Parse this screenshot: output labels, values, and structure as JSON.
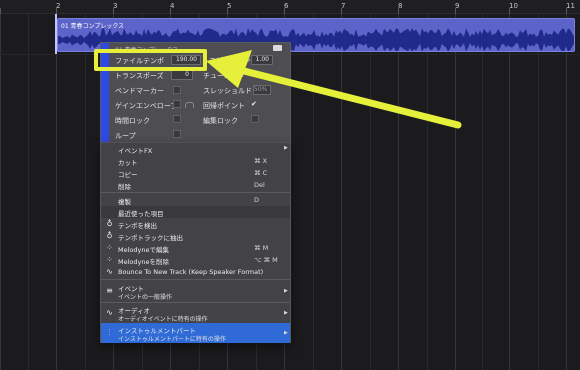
{
  "ruler": {
    "ticks": [
      "2",
      "3",
      "4",
      "5",
      "6",
      "7",
      "8",
      "9",
      "10",
      "11"
    ]
  },
  "audio_event": {
    "name": "01 青春コンプレックス"
  },
  "info_panel": {
    "header": "01 青春コンプレックス",
    "file_tempo_label": "ファイルテンポ",
    "file_tempo_value": "190.00",
    "speed_label": "スピードファクタ",
    "speed_value": "1.00",
    "transpose_label": "トランスポーズ",
    "transpose_value": "0",
    "tuning_label": "チューニング",
    "bend_marker_label": "ベンドマーカー",
    "slash_label": "スレッショルド",
    "slash_value": "50%",
    "gain_env_label": "ゲインエンベロープ",
    "return_point_label": "回帰ポイント",
    "time_lock_label": "時間ロック",
    "edit_lock_label": "編集ロック",
    "loop_label": "ループ"
  },
  "context_menu": {
    "items": [
      {
        "label": "イベントFX",
        "shortcut": "",
        "arrow": "▶"
      },
      {
        "label": "カット",
        "shortcut": "⌘ X"
      },
      {
        "label": "コピー",
        "shortcut": "⌘ C"
      },
      {
        "label": "削除",
        "shortcut": "Del"
      },
      {
        "label": "複製",
        "shortcut": "D"
      },
      {
        "label": "最近使った項目",
        "shortcut": ""
      },
      {
        "label": "テンポを検出",
        "shortcut": "",
        "icon": "tempo-detect-icon"
      },
      {
        "label": "テンポトラックに抽出",
        "shortcut": "",
        "icon": "tempo-extract-icon"
      },
      {
        "label": "Melodyneで編集",
        "shortcut": "⌘ M",
        "icon": "melodyne-edit-icon"
      },
      {
        "label": "Melodyneを削除",
        "shortcut": "⌥ ⌘ M",
        "icon": "melodyne-remove-icon"
      },
      {
        "label": "Bounce To New Track (Keep Speaker Format)",
        "shortcut": "",
        "icon": "bounce-icon"
      }
    ],
    "groups": [
      {
        "label": "イベント",
        "sub": "イベントの一般操作",
        "arrow": "▶",
        "icon": "event-icon"
      },
      {
        "label": "オーディオ",
        "sub": "オーディオイベントに特有の操作",
        "arrow": "▶",
        "icon": "audio-icon"
      },
      {
        "label": "インストゥルメントパート",
        "sub": "インストゥルメントパートに特有の操作",
        "arrow": "▶",
        "icon": "instrument-icon"
      }
    ]
  },
  "colors": {
    "highlight": "#e6f03a",
    "selected": "#2f6ad6",
    "event": "#5d64c9"
  }
}
